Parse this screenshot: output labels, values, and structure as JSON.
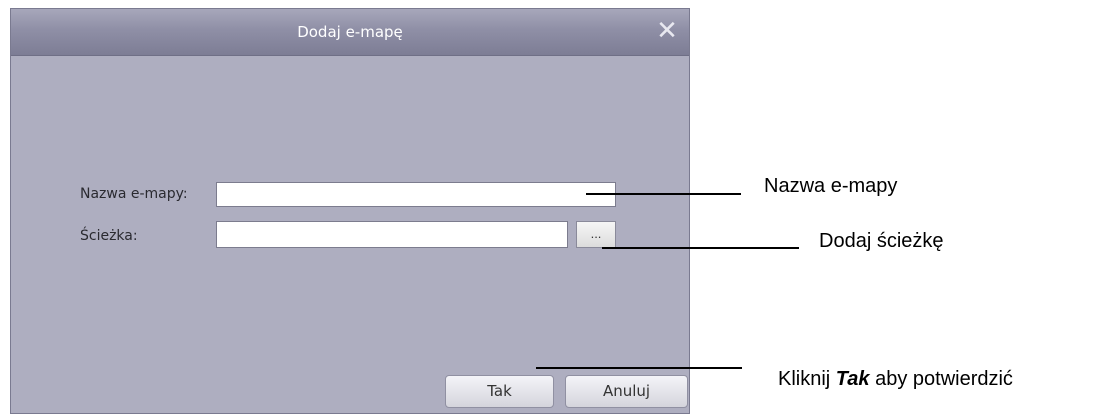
{
  "dialog": {
    "title": "Dodaj e-mapę",
    "close_glyph": "✕",
    "name_label": "Nazwa e-mapy:",
    "name_value": "",
    "path_label": "Ścieżka:",
    "path_value": "",
    "browse_label": "...",
    "ok_label": "Tak",
    "cancel_label": "Anuluj"
  },
  "annotations": {
    "name": "Nazwa e-mapy",
    "path": "Dodaj ścieżkę",
    "confirm_prefix": "Kliknij ",
    "confirm_bold": "Tak",
    "confirm_suffix": " aby potwierdzić"
  },
  "colors": {
    "dialog_bg": "#aeaec0",
    "titlebar": "#8f8fa6"
  },
  "icons": {
    "close": "close-icon"
  }
}
